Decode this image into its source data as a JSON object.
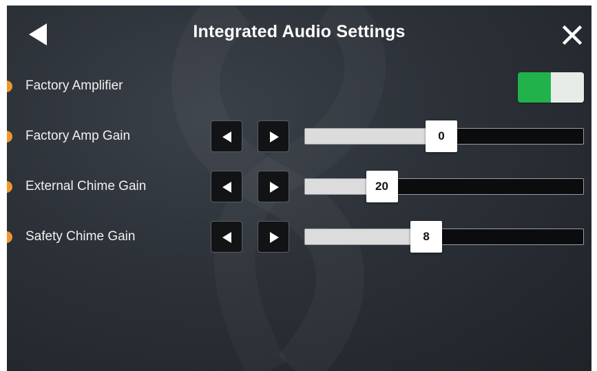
{
  "header": {
    "title": "Integrated Audio Settings",
    "back_icon": "back-arrow-icon",
    "close_icon": "close-icon"
  },
  "colors": {
    "accent_dot": "#f0962e",
    "toggle_on": "#22b24c",
    "background": "#2c3138"
  },
  "factory_amplifier": {
    "label": "Factory Amplifier",
    "enabled": true
  },
  "sliders": [
    {
      "id": "factory-amp-gain",
      "label": "Factory Amp Gain",
      "value": "0",
      "fill_fraction": 0.49
    },
    {
      "id": "external-chime-gain",
      "label": "External Chime Gain",
      "value": "20",
      "fill_fraction": 0.276
    },
    {
      "id": "safety-chime-gain",
      "label": "Safety Chime Gain",
      "value": "8",
      "fill_fraction": 0.436
    }
  ]
}
